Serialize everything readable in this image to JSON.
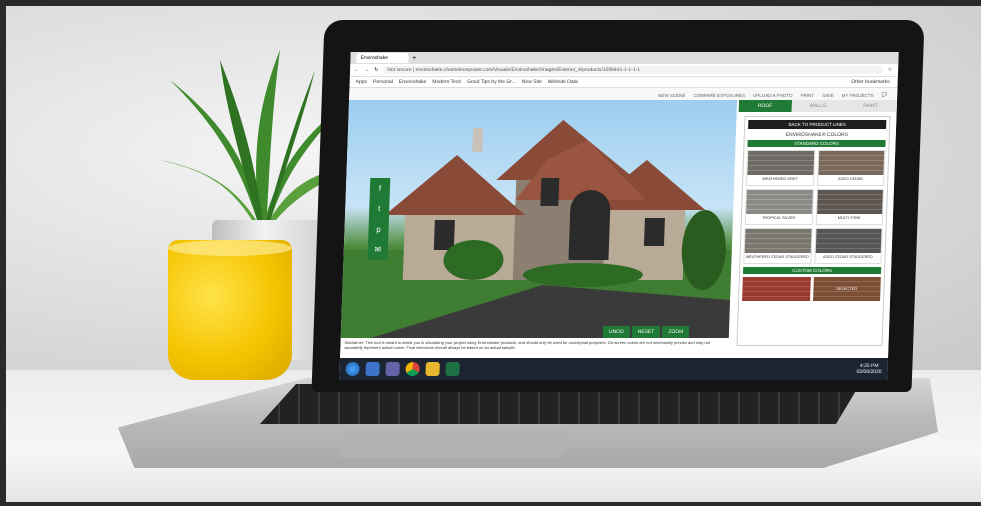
{
  "browser": {
    "tab_label": "Enviroshake",
    "url": "enviroshake.chameleonpower.com/Visuals/Enviroshake/Images/Exterior_4/products/1006441-1-1-1-1",
    "not_secure": "Not secure",
    "bookmarks": [
      "Apps",
      "Personal",
      "Enviroshake",
      "Modern Tech",
      "Good Tips by the Gr...",
      "New Site",
      "Website Data"
    ],
    "other_bookmarks": "Other bookmarks"
  },
  "site_nav": [
    "NEW SCENE",
    "COMPARE EXPOSURES",
    "UPLOAD A PHOTO",
    "PRINT",
    "SAVE",
    "MY PROJECTS"
  ],
  "panel": {
    "tabs": [
      "ROOF",
      "WALLS",
      "PAINT"
    ],
    "back_label": "BACK TO PRODUCT LINES",
    "title": "ENVIROSHAKE® COLORS",
    "standard_header": "STANDARD COLORS",
    "swatches": [
      {
        "name": "WEATHERED GREY",
        "color": "#6e6a66"
      },
      {
        "name": "AGED CEDAR",
        "color": "#7b6a5c"
      },
      {
        "name": "TROPICAL SILVER",
        "color": "#8c8a86"
      },
      {
        "name": "MULTI-TONE",
        "color": "#5e5650"
      },
      {
        "name": "WEATHERED CEDAR STAGGERED",
        "color": "#7a756f"
      },
      {
        "name": "AGED CEDAR STAGGERED",
        "color": "#585654"
      }
    ],
    "custom_header": "CUSTOM COLORS",
    "custom": [
      {
        "name": "",
        "color": "#9a3a2e"
      },
      {
        "name": "SELECTED",
        "color": "#7a4f36"
      }
    ]
  },
  "social": [
    "f",
    "t",
    "p",
    "✉"
  ],
  "tools": [
    "UNDO",
    "RESET",
    "ZOOM"
  ],
  "disclaimer": "Disclaimer: This tool is meant to assist you in visualizing your project using Enviroshake products, and should only be used for conceptual purposes. On-screen colors are not necessarily precise and may not accurately represent actual colors. Final selections should always be based on an actual sample.",
  "taskbar": {
    "time": "4:25 PM",
    "date": "02/06/2020"
  },
  "colors": {
    "accent": "#1f7a35",
    "mug": "#f5c400"
  }
}
